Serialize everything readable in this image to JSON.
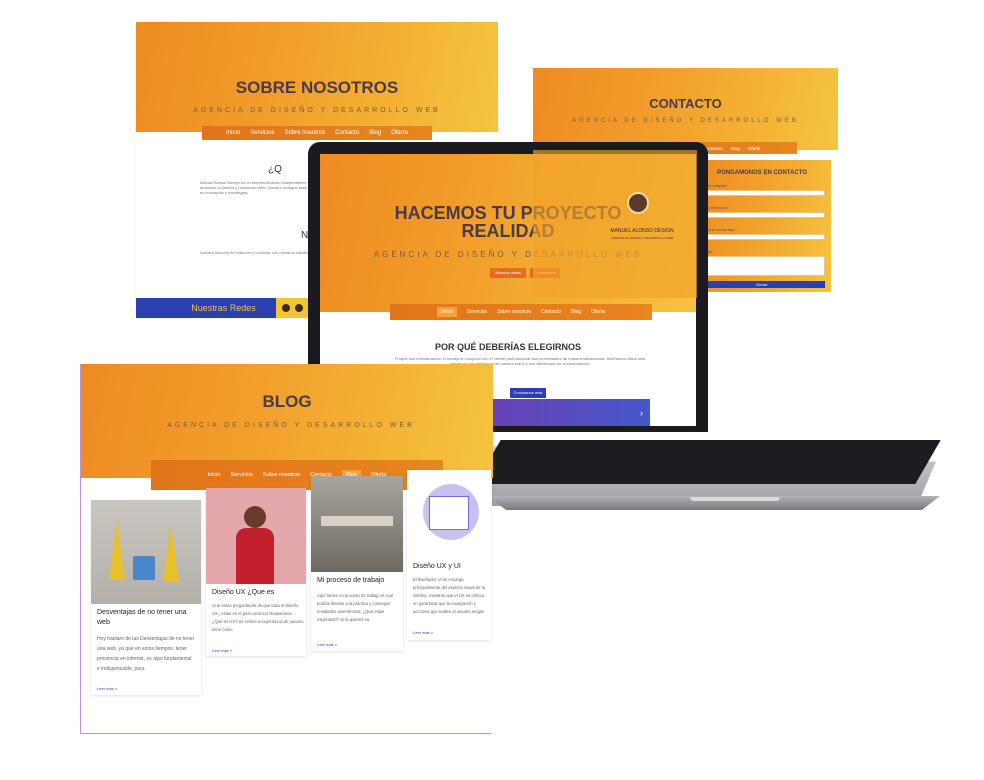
{
  "about": {
    "title": "SOBRE NOSOTROS",
    "subtitle": "AGENCIA DE DISEÑO Y DESARROLLO WEB",
    "nav": [
      "Inicio",
      "Servicios",
      "Sobre nosotros",
      "Contacto",
      "Blog",
      "Oferta"
    ],
    "question_fragment": "¿Q",
    "heading_fragment": "N",
    "body_fragment": "Manuel Alonso Design es un emprendimiento independiente dedicado al Diseño y Desarrollo Web. Nuestro enfoque está en conceptos y estrategias",
    "body_fragment2": "Nuestra filosofía es entender y conectar con nuestros clientes",
    "social_label": "Nuestras Redes"
  },
  "contact": {
    "title": "CONTACTO",
    "subtitle": "AGENCIA DE DISEÑO Y DESARROLLO WEB",
    "nav": [
      "Inicio",
      "Servicios",
      "Sobre nosotros",
      "Contacto",
      "Blog",
      "Oferta"
    ],
    "form_title": "PONGAMONOS EN CONTACTO",
    "fields": [
      "Nombre completo",
      "Correo electrónico",
      "Escriba su asunto aquí",
      "Mensaje"
    ],
    "submit_label": "Enviar",
    "brand": "MANUEL ALONSO DESIGN",
    "brand_sub": "AGENCIA DE DISEÑO Y DESARROLLO WEB"
  },
  "laptop": {
    "hero_title_line1": "HACEMOS TU PROYECTO",
    "hero_title_line2": "REALIDAD",
    "hero_subtitle": "AGENCIA DE DISEÑO Y DESARROLLO WEB",
    "cta_primary": "Nuestra oferta",
    "cta_secondary": "Contáctanos",
    "nav": [
      "Inicio",
      "Servicios",
      "Sobre nosotros",
      "Contacto",
      "Blog",
      "Oferta"
    ],
    "section_title": "POR QUÉ DEBERÍAS ELEGIRNOS",
    "section_body": "Porque nos enfocamos en el trabajo en conjunto con el cliente para alcanzar sus necesidades de manera satisfactoria. Diseñamos sitios web atractivos que distinguen de manera única y nos diferencian de la competencia.",
    "section_button": "Conócenos más"
  },
  "blog": {
    "title": "BLOG",
    "subtitle": "AGENCIA DE DISEÑO Y DESARROLLO WEB",
    "nav": [
      "Inicio",
      "Servicios",
      "Sobre nosotros",
      "Contacto",
      "Blog",
      "Oferta"
    ],
    "posts": [
      {
        "title": "Desventajas de no tener una web",
        "body": "Hoy hablare de las Desventajas de no tener una web, ya que en estos tiempos, tener presencia en internet, es algo fundamental e indispensable, para",
        "more": "Leer más »"
      },
      {
        "title": "Diseño UX ¿Que es",
        "body": "Si te estas preguntando de que trata el Diseño UX , estas en el post correcto! Repasemos... ¿Qué es UX? Se refiere a experiencia de usuario tiene como",
        "more": "Leer más »"
      },
      {
        "title": "Mi proceso de trabajo",
        "body": "Aquí tienes un proceso de trabajo el cual podrás llevarlo a la práctica y conseguir resultados asombrosos. ¿Que estas esperando? Si te quieres sa",
        "more": "Leer más »"
      },
      {
        "title": "Diseño UX y UI",
        "body": "El diseñador UI se encarga principalmente del aspecto visual de la interfaz, mientras que el UX se enfoca en garantizar que la navegación y acciones que realice el usuario tengan",
        "more": "Leer más »"
      }
    ]
  },
  "colors": {
    "orange": "#f1a12a",
    "navy": "#2b3fb0",
    "title_text": "#4a3a4a"
  }
}
